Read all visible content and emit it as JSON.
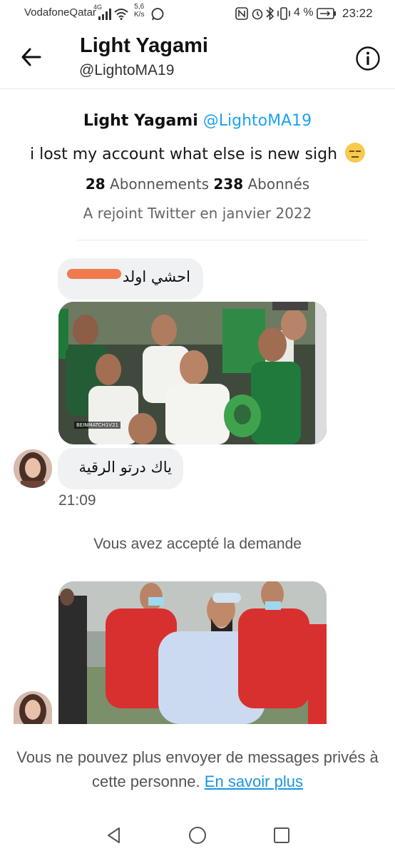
{
  "status_bar": {
    "carrier": "VodafoneQatar",
    "network": "4G",
    "speed_value": "5,6",
    "speed_unit": "K/s",
    "battery": "4 %",
    "time": "23:22"
  },
  "header": {
    "title": "Light Yagami",
    "handle": "@LightoMA19"
  },
  "profile": {
    "name": "Light Yagami",
    "handle": "@LightoMA19",
    "bio": "i lost my account  what else is new sigh",
    "following_count": "28",
    "following_label": "Abonnements",
    "followers_count": "238",
    "followers_label": "Abonnés",
    "joined": "A rejoint Twitter en janvier 2022"
  },
  "messages": {
    "msg1_text": "احشي اولد",
    "msg2_text": "ياك درتو الرقية",
    "time": "21:09",
    "system": "Vous avez accepté la demande",
    "image1_caption": "BEINMATCH1V21"
  },
  "footer": {
    "notice": "Vous ne pouvez plus envoyer de messages privés à cette personne.",
    "learn_more": "En savoir plus"
  },
  "colors": {
    "accent": "#1da1f2",
    "bubble": "#eff1f3",
    "link": "#1b95e0"
  }
}
